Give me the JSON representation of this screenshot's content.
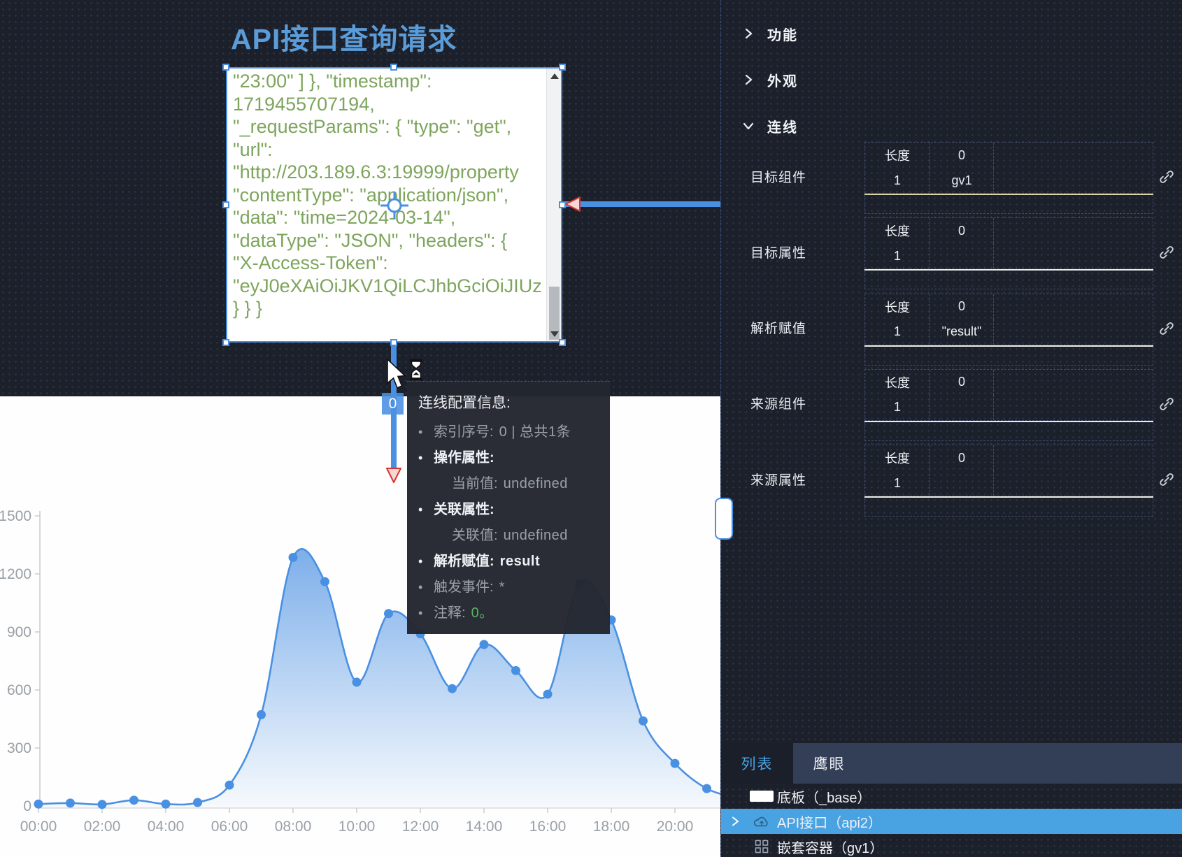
{
  "canvas": {
    "title": "API接口查询请求",
    "textbox": {
      "lines": [
        "\"23:00\" ] }, \"timestamp\":",
        "1719455707194,",
        "\"_requestParams\": { \"type\": \"get\",",
        "\"url\":",
        "\"http://203.189.6.3:19999/property",
        "\"contentType\": \"application/json\",",
        "\"data\": \"time=2024-03-14\",",
        "\"dataType\": \"JSON\", \"headers\": {",
        "\"X-Access-Token\":",
        "\"eyJ0eXAiOiJKV1QiLCJhbGciOiJIUz",
        "} } }"
      ]
    },
    "connector": {
      "badge": "0"
    },
    "tooltip": {
      "title": "连线配置信息:",
      "items": [
        {
          "style": "muted",
          "bullet": "•",
          "label": "索引序号:",
          "value": "0 | 总共1条"
        },
        {
          "style": "strong",
          "bullet": "•",
          "label": "操作属性:",
          "value": ""
        },
        {
          "style": "sub",
          "bullet": "",
          "label": "当前值:",
          "value": "undefined"
        },
        {
          "style": "strong",
          "bullet": "•",
          "label": "关联属性:",
          "value": ""
        },
        {
          "style": "sub",
          "bullet": "",
          "label": "关联值:",
          "value": "undefined"
        },
        {
          "style": "strong",
          "bullet": "•",
          "label": "解析赋值:",
          "value": "result"
        },
        {
          "style": "muted",
          "bullet": "•",
          "label": "触发事件:",
          "value": "*"
        },
        {
          "style": "muted",
          "bullet": "•",
          "label": "注释:",
          "value": "0。",
          "value_color": "#57b25e"
        }
      ]
    }
  },
  "chart_data": {
    "type": "area",
    "title": "",
    "xlabel": "",
    "ylabel": "",
    "x_hours": [
      0,
      1,
      2,
      3,
      4,
      5,
      6,
      7,
      8,
      9,
      10,
      11,
      12,
      13,
      14,
      15,
      16,
      17,
      18,
      19,
      20,
      21
    ],
    "values": [
      10,
      15,
      8,
      30,
      10,
      18,
      108,
      472,
      1285,
      1160,
      640,
      995,
      890,
      607,
      835,
      700,
      578,
      1150,
      962,
      440,
      220,
      90
    ],
    "x_tick_labels": [
      "00:00",
      "02:00",
      "04:00",
      "06:00",
      "08:00",
      "10:00",
      "12:00",
      "14:00",
      "16:00",
      "18:00",
      "20:00"
    ],
    "y_ticks": [
      0,
      300,
      600,
      900,
      1200,
      1500
    ],
    "ylim": [
      0,
      1500
    ],
    "grid": false,
    "legend": null,
    "line_color": "#4a90e2",
    "axis_text_color": "#9aa0a6",
    "smooth": true,
    "markers": "circle"
  },
  "panel": {
    "sections": [
      {
        "label": "功能",
        "expanded": false
      },
      {
        "label": "外观",
        "expanded": false
      },
      {
        "label": "连线",
        "expanded": true
      }
    ],
    "fields": [
      {
        "label": "目标组件",
        "row1": [
          "长度",
          "0"
        ],
        "row2": [
          "1",
          "gv1"
        ],
        "underline": "#d9d3a9"
      },
      {
        "label": "目标属性",
        "row1": [
          "长度",
          "0"
        ],
        "row2": [
          "1",
          ""
        ],
        "underline": "#edece2"
      },
      {
        "label": "解析赋值",
        "row1": [
          "长度",
          "0"
        ],
        "row2": [
          "1",
          "\"result\""
        ],
        "underline": "#edece2"
      },
      {
        "label": "来源组件",
        "row1": [
          "长度",
          "0"
        ],
        "row2": [
          "1",
          ""
        ],
        "underline": "#edece2"
      },
      {
        "label": "来源属性",
        "row1": [
          "长度",
          "0"
        ],
        "row2": [
          "1",
          ""
        ],
        "underline": "#edece2"
      }
    ]
  },
  "bottom_panel": {
    "tabs": [
      {
        "label": "列表",
        "active": true
      },
      {
        "label": "鹰眼",
        "active": false
      }
    ],
    "items": [
      {
        "icon": "plate",
        "label": "底板（_base）",
        "selected": false,
        "chevron": false
      },
      {
        "icon": "cloud",
        "label": "API接口（api2）",
        "selected": true,
        "chevron": true
      },
      {
        "icon": "grid",
        "label": "嵌套容器（gv1）",
        "selected": false,
        "chevron": false
      }
    ]
  }
}
